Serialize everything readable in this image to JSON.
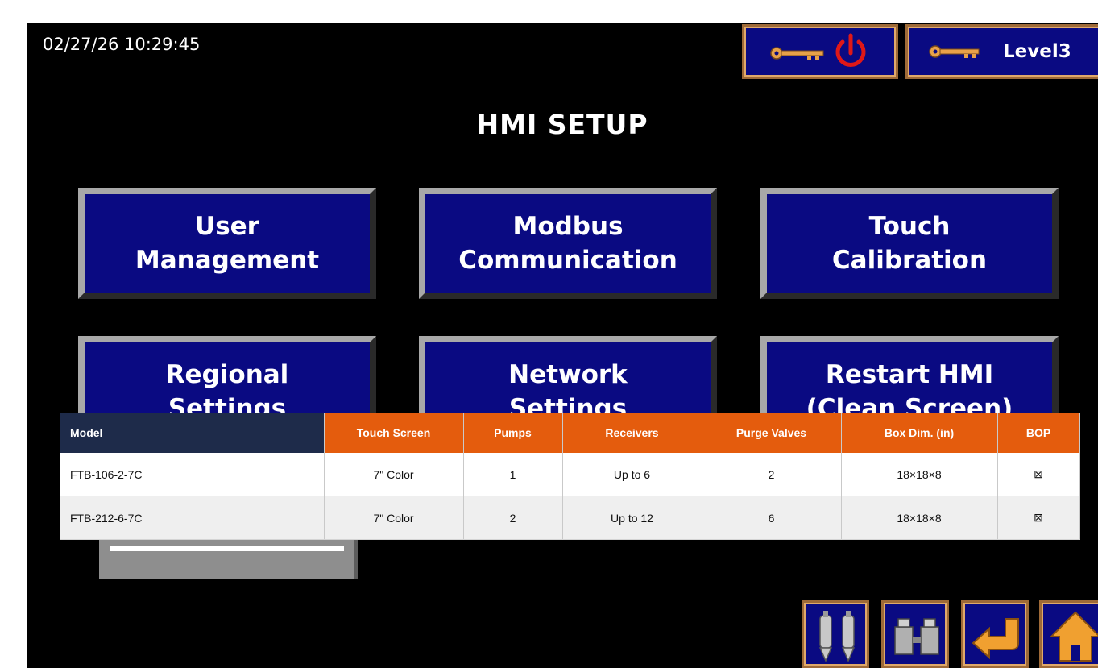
{
  "hmi": {
    "datetime": "02/27/26 10:29:45",
    "title": "HMI SETUP",
    "user_level": "Level3",
    "menu": [
      {
        "line1": "User",
        "line2": "Management"
      },
      {
        "line1": "Modbus",
        "line2": "Communication"
      },
      {
        "line1": "Touch",
        "line2": "Calibration"
      },
      {
        "line1": "Regional",
        "line2": "Settings"
      },
      {
        "line1": "Network",
        "line2": "Settings"
      },
      {
        "line1": "Restart HMI",
        "line2": "(Clean Screen)"
      }
    ],
    "nav_icons": [
      "pumps-icon",
      "valves-icon",
      "back-arrow-icon",
      "home-icon"
    ],
    "colors": {
      "button_blue": "#0a0a82",
      "button_frame": "#e0a96a",
      "key": "#e8a14a",
      "power": "#e01818"
    }
  },
  "table": {
    "headers": [
      "Model",
      "Touch Screen",
      "Pumps",
      "Receivers",
      "Purge Valves",
      "Box Dim. (in)",
      "BOP"
    ],
    "rows": [
      [
        "FTB-106-2-7C",
        "7\" Color",
        "1",
        "Up to 6",
        "2",
        "18×18×8",
        "⊠"
      ],
      [
        "FTB-212-6-7C",
        "7\" Color",
        "2",
        "Up to 12",
        "6",
        "18×18×8",
        "⊠"
      ]
    ],
    "colors": {
      "header_orange": "#e45c0d",
      "header_navy": "#1e2b4a"
    }
  }
}
